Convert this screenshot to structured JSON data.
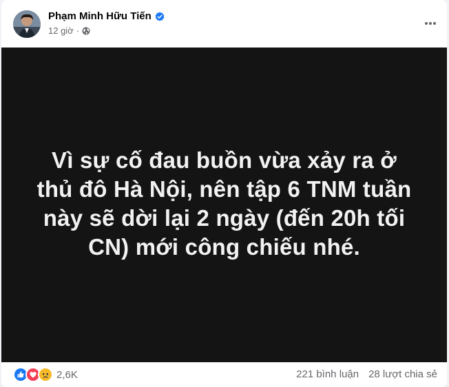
{
  "post": {
    "author": "Phạm Minh Hữu Tiến",
    "timestamp": "12 giờ",
    "separator": "·",
    "audience_icon": "globe-icon",
    "verified_icon": "verified-badge-icon",
    "more_icon": "more-horizontal-icon"
  },
  "image": {
    "text": "Vì sự cố đau buồn vừa xảy ra ở thủ đô Hà Nội, nên tập 6 TNM tuần này sẽ dời lại 2 ngày (đến 20h tối CN) mới công chiếu nhé.",
    "background": "#141414"
  },
  "footer": {
    "reaction_icons": [
      "like-icon",
      "love-icon",
      "sad-icon"
    ],
    "reaction_count": "2,6K",
    "comments": "221 bình luận",
    "shares": "28 lượt chia sẻ"
  },
  "colors": {
    "verified_blue": "#1877f2",
    "like_blue": "#1877f2",
    "love_red": "#f33e58",
    "sad_yellow": "#f7b928",
    "secondary_text": "#65676b"
  }
}
